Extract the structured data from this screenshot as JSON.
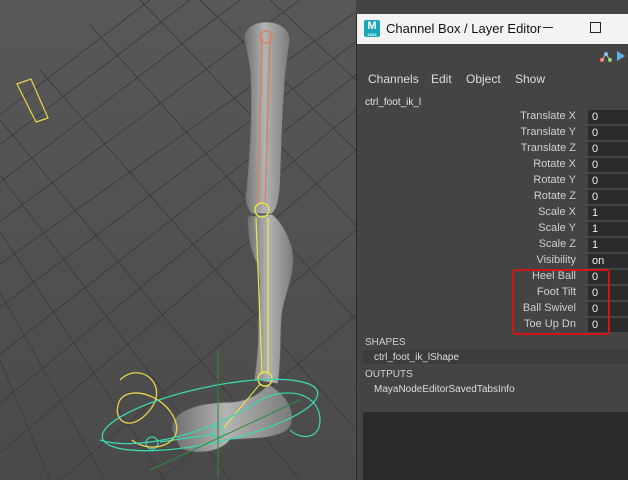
{
  "window": {
    "title": "Channel Box / Layer Editor",
    "app_icon": "maya-icon",
    "app_icon_text": "M",
    "app_icon_subtext": "2024"
  },
  "menu": {
    "items": [
      "Channels",
      "Edit",
      "Object",
      "Show"
    ]
  },
  "node": {
    "name": "ctrl_foot_ik_l"
  },
  "attributes": [
    {
      "label": "Translate X",
      "value": "0"
    },
    {
      "label": "Translate Y",
      "value": "0"
    },
    {
      "label": "Translate Z",
      "value": "0"
    },
    {
      "label": "Rotate X",
      "value": "0"
    },
    {
      "label": "Rotate Y",
      "value": "0"
    },
    {
      "label": "Rotate Z",
      "value": "0"
    },
    {
      "label": "Scale X",
      "value": "1"
    },
    {
      "label": "Scale Y",
      "value": "1"
    },
    {
      "label": "Scale Z",
      "value": "1"
    },
    {
      "label": "Visibility",
      "value": "on"
    },
    {
      "label": "Heel Ball",
      "value": "0"
    },
    {
      "label": "Foot Tilt",
      "value": "0"
    },
    {
      "label": "Ball Swivel",
      "value": "0"
    },
    {
      "label": "Toe Up Dn",
      "value": "0"
    }
  ],
  "shapes": {
    "header": "SHAPES",
    "items": [
      "ctrl_foot_ik_lShape"
    ]
  },
  "outputs": {
    "header": "OUTPUTS",
    "items": [
      "MayaNodeEditorSavedTabsInfo"
    ]
  },
  "colors": {
    "highlight": "#d41515",
    "joint_upper": "#e07a55",
    "joint_lower": "#e8e84a",
    "control_yellow": "#e8d44a",
    "control_cyan": "#3cd6b0"
  }
}
